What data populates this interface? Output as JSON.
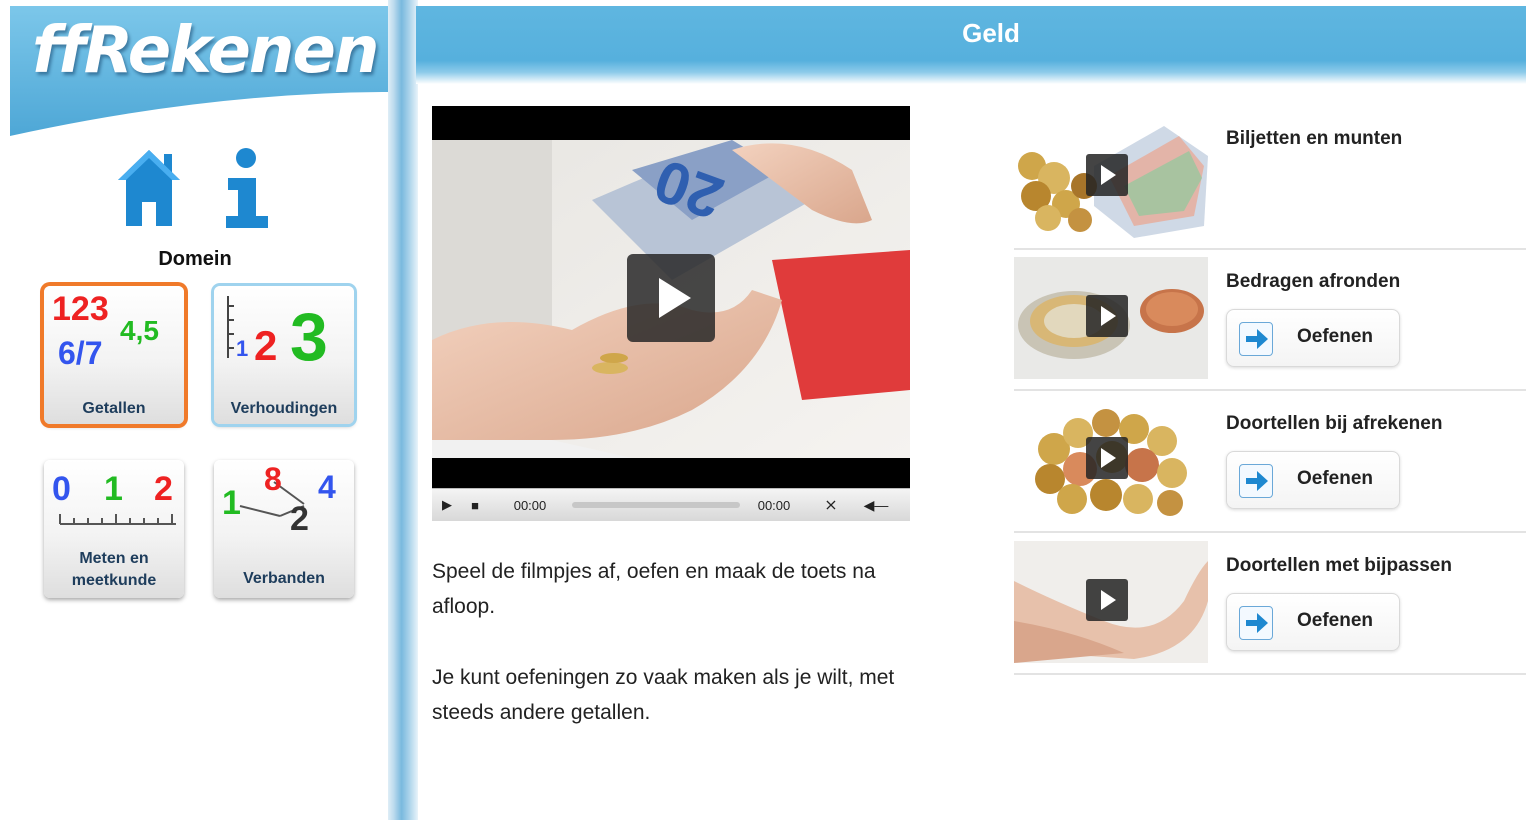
{
  "app": {
    "logo": "ffRekenen"
  },
  "header": {
    "title": "Geld"
  },
  "sidebar": {
    "domain_label": "Domein",
    "home_icon": "home-icon",
    "info_icon": "info-icon",
    "tiles": [
      {
        "label": "Getallen",
        "selected": true,
        "icon_text": [
          "123",
          "4,5",
          "6/7"
        ]
      },
      {
        "label": "Verhoudingen",
        "selected": false,
        "icon_text": [
          "1",
          "2",
          "3"
        ]
      },
      {
        "label": "Meten en meetkunde",
        "selected": false,
        "icon_text": [
          "0",
          "1",
          "2"
        ]
      },
      {
        "label": "Verbanden",
        "selected": false,
        "icon_text": [
          "1",
          "8",
          "2",
          "4"
        ]
      }
    ]
  },
  "video": {
    "current_time": "00:00",
    "duration": "00:00",
    "play_icon": "play-icon",
    "stop_icon": "stop-icon",
    "fullscreen_icon": "fullscreen-icon",
    "volume_icon": "volume-icon"
  },
  "description": {
    "p1": "Speel de filmpjes af, oefen en maak de toets na afloop.",
    "p2": "Je kunt oefeningen zo vaak maken als je wilt, met steeds andere getallen."
  },
  "lessons": [
    {
      "title": "Biljetten en munten",
      "has_practice": false
    },
    {
      "title": "Bedragen afronden",
      "has_practice": true,
      "button_label": "Oefenen"
    },
    {
      "title": "Doortellen bij afrekenen",
      "has_practice": true,
      "button_label": "Oefenen"
    },
    {
      "title": "Doortellen met bijpassen",
      "has_practice": true,
      "button_label": "Oefenen"
    }
  ],
  "colors": {
    "header_blue": "#5fb6e0",
    "selected_orange": "#f07a2a",
    "icon_blue": "#1e88d0"
  }
}
